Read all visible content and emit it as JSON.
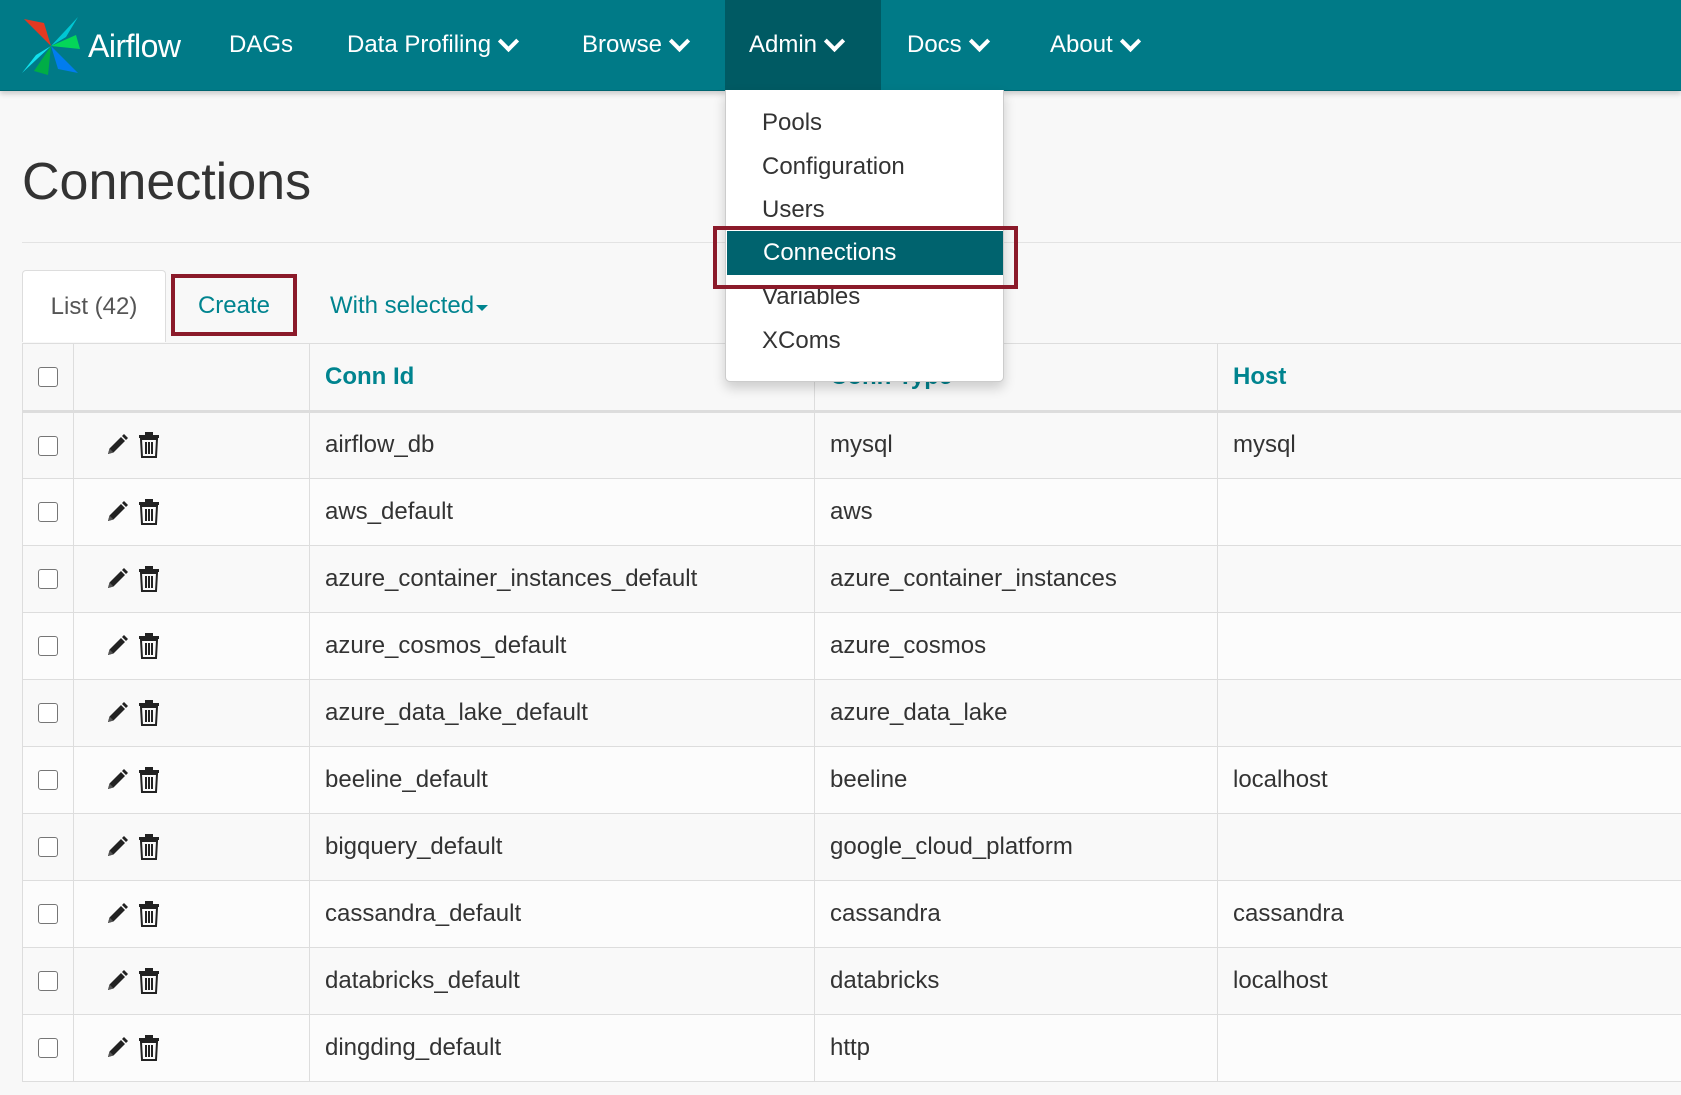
{
  "nav": {
    "brand": "Airflow",
    "items": [
      {
        "label": "DAGs"
      },
      {
        "label": "Data Profiling"
      },
      {
        "label": "Browse"
      },
      {
        "label": "Admin"
      },
      {
        "label": "Docs"
      },
      {
        "label": "About"
      }
    ],
    "active": "Admin"
  },
  "admin_menu": {
    "items": [
      {
        "label": "Pools"
      },
      {
        "label": "Configuration"
      },
      {
        "label": "Users"
      },
      {
        "label": "Connections"
      },
      {
        "label": "Variables"
      },
      {
        "label": "XComs"
      }
    ],
    "selected": "Connections"
  },
  "page": {
    "title": "Connections"
  },
  "tabs": {
    "list": "List (42)",
    "create": "Create",
    "with_selected": "With selected"
  },
  "table": {
    "columns": [
      "",
      "",
      "Conn Id",
      "Conn Type",
      "Host"
    ],
    "rows": [
      {
        "conn_id": "airflow_db",
        "conn_type": "mysql",
        "host": "mysql"
      },
      {
        "conn_id": "aws_default",
        "conn_type": "aws",
        "host": ""
      },
      {
        "conn_id": "azure_container_instances_default",
        "conn_type": "azure_container_instances",
        "host": ""
      },
      {
        "conn_id": "azure_cosmos_default",
        "conn_type": "azure_cosmos",
        "host": ""
      },
      {
        "conn_id": "azure_data_lake_default",
        "conn_type": "azure_data_lake",
        "host": ""
      },
      {
        "conn_id": "beeline_default",
        "conn_type": "beeline",
        "host": "localhost"
      },
      {
        "conn_id": "bigquery_default",
        "conn_type": "google_cloud_platform",
        "host": ""
      },
      {
        "conn_id": "cassandra_default",
        "conn_type": "cassandra",
        "host": "cassandra"
      },
      {
        "conn_id": "databricks_default",
        "conn_type": "databricks",
        "host": "localhost"
      },
      {
        "conn_id": "dingding_default",
        "conn_type": "http",
        "host": ""
      }
    ]
  },
  "colors": {
    "navbar": "#007a87",
    "navbar_active": "#005a63",
    "link": "#00848f",
    "highlight_box": "#8b1a2a",
    "menu_selected": "#00636e"
  },
  "icons": {
    "edit": "pencil-icon",
    "delete": "trash-icon",
    "brand": "pinwheel-logo"
  }
}
